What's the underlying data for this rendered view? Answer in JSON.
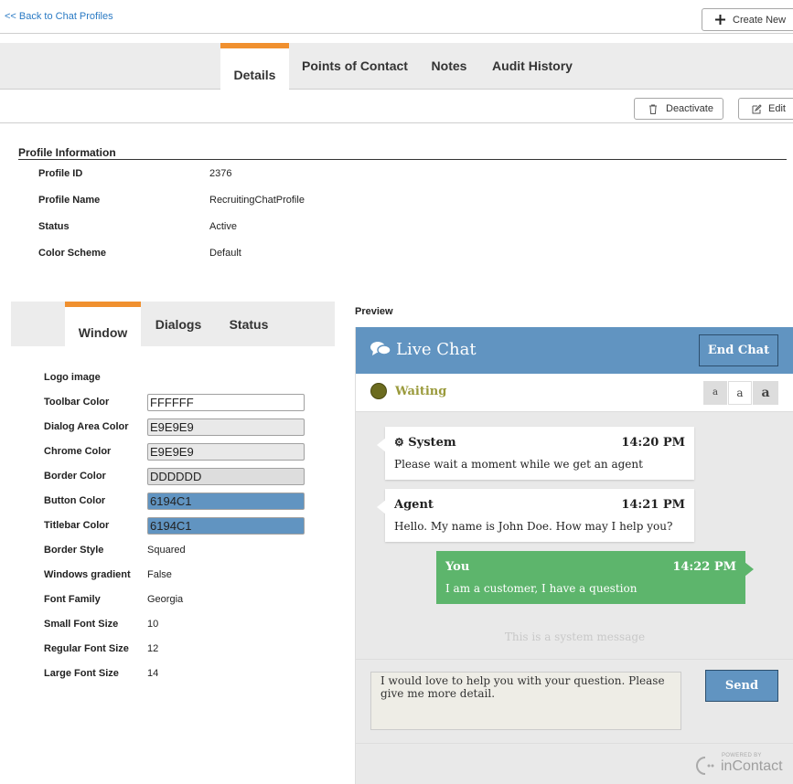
{
  "nav": {
    "back_link": "<< Back to Chat Profiles",
    "create_new": "Create New"
  },
  "main_tabs": [
    "Details",
    "Points of Contact",
    "Notes",
    "Audit History"
  ],
  "actions": {
    "deactivate": "Deactivate",
    "edit": "Edit"
  },
  "profile": {
    "section_title": "Profile Information",
    "fields": [
      {
        "label": "Profile ID",
        "value": "2376"
      },
      {
        "label": "Profile Name",
        "value": "RecruitingChatProfile"
      },
      {
        "label": "Status",
        "value": "Active"
      },
      {
        "label": "Color Scheme",
        "value": "Default"
      }
    ]
  },
  "sub_tabs": [
    "Window",
    "Dialogs",
    "Status"
  ],
  "window_settings": {
    "logo_label": "Logo image",
    "colors": [
      {
        "label": "Toolbar Color",
        "value": "FFFFFF",
        "bg": "#FFFFFF"
      },
      {
        "label": "Dialog Area Color",
        "value": "E9E9E9",
        "bg": "#E9E9E9"
      },
      {
        "label": "Chrome Color",
        "value": "E9E9E9",
        "bg": "#E9E9E9"
      },
      {
        "label": "Border Color",
        "value": "DDDDDD",
        "bg": "#DDDDDD"
      },
      {
        "label": "Button Color",
        "value": "6194C1",
        "bg": "#6194C1"
      },
      {
        "label": "Titlebar Color",
        "value": "6194C1",
        "bg": "#6194C1"
      }
    ],
    "fields": [
      {
        "label": "Border Style",
        "value": "Squared"
      },
      {
        "label": "Windows gradient",
        "value": "False"
      },
      {
        "label": "Font Family",
        "value": "Georgia"
      },
      {
        "label": "Small Font Size",
        "value": "10"
      },
      {
        "label": "Regular Font Size",
        "value": "12"
      },
      {
        "label": "Large Font Size",
        "value": "14"
      }
    ]
  },
  "preview": {
    "label": "Preview",
    "title": "Live Chat",
    "end_chat": "End Chat",
    "status": "Waiting",
    "font_buttons": [
      "a",
      "a",
      "a"
    ],
    "messages": [
      {
        "name": "System",
        "time": "14:20 PM",
        "text": "Please wait a moment while we get an agent"
      },
      {
        "name": "Agent",
        "time": "14:21 PM",
        "text": "Hello. My name is John Doe. How may I help you?"
      },
      {
        "name": "You",
        "time": "14:22 PM",
        "text": "I am a customer, I have a question"
      }
    ],
    "system_message": "This is a system message",
    "input_text": "I would love to help you with your question. Please give me more detail.",
    "send": "Send",
    "powered_by": "POWERED BY",
    "brand": "inContact"
  },
  "colors": {
    "accent": "#f0902f",
    "link": "#2a7ac4",
    "titlebar": "#6194C1",
    "you_bubble": "#5db56c",
    "status_dot": "#6b6b1f"
  }
}
